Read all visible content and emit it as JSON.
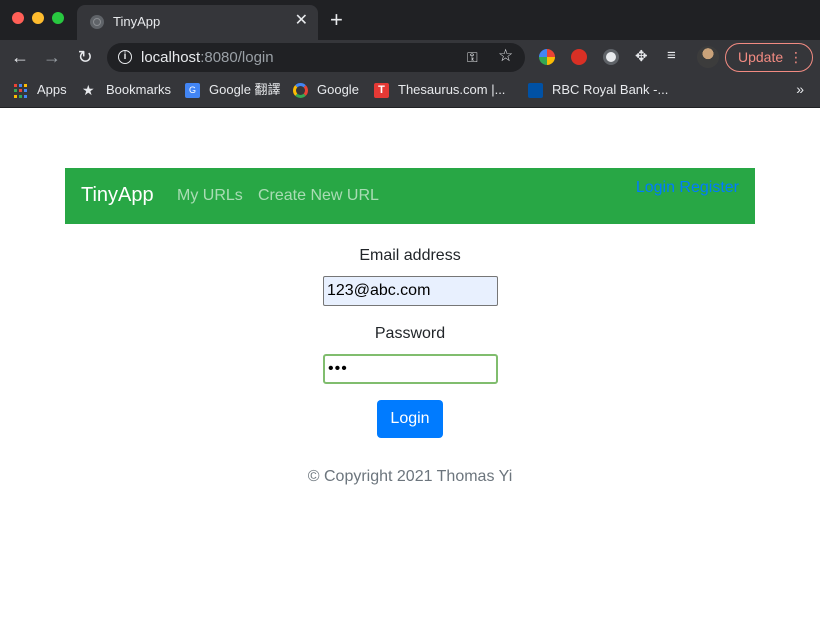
{
  "browser": {
    "tab_title": "TinyApp",
    "tab_close": "✕",
    "new_tab": "+",
    "url_host": "localhost",
    "url_rest": ":8080/login",
    "update_label": "Update",
    "update_menu": "⋮",
    "bookmarks": [
      {
        "label": "Apps",
        "icon": "apps-grid-icon"
      },
      {
        "label": "Bookmarks",
        "icon": "star-icon"
      },
      {
        "label": "Google 翻譯",
        "icon": "google-translate-icon"
      },
      {
        "label": "Google",
        "icon": "google-icon"
      },
      {
        "label": "Thesaurus.com |...",
        "icon": "thesaurus-icon"
      },
      {
        "label": "RBC Royal Bank -...",
        "icon": "rbc-icon"
      }
    ],
    "bookmarks_more": "»"
  },
  "navbar": {
    "brand": "TinyApp",
    "links": [
      "My URLs",
      "Create New URL"
    ],
    "right_links": "Login Register",
    "bg_color": "#28a745"
  },
  "form": {
    "email_label": "Email address",
    "email_value": "123@abc.com",
    "password_label": "Password",
    "password_value": "•••",
    "submit_label": "Login"
  },
  "footer": {
    "text": "© Copyright 2021 Thomas Yi"
  }
}
